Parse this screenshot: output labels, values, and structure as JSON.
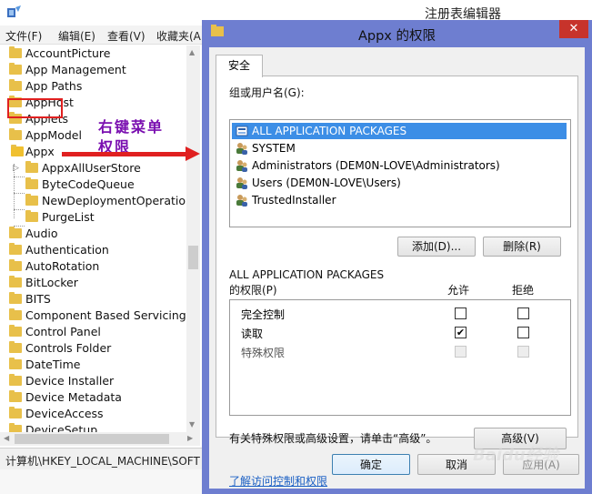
{
  "registry": {
    "title": "注册表编辑器",
    "menu": [
      "文件(F)",
      "编辑(E)",
      "查看(V)",
      "收藏夹(A"
    ],
    "tree_top": [
      "AccountPicture",
      "App Management",
      "App Paths",
      "AppHost",
      "Applets",
      "AppModel"
    ],
    "selected_key": "Appx",
    "children": [
      "AppxAllUserStore",
      "ByteCodeQueue",
      "NewDeploymentOperation",
      "PurgeList"
    ],
    "tree_bottom": [
      "Audio",
      "Authentication",
      "AutoRotation",
      "BitLocker",
      "BITS",
      "Component Based Servicing",
      "Control Panel",
      "Controls Folder",
      "DateTime",
      "Device Installer",
      "Device Metadata",
      "DeviceAccess",
      "DeviceSetup"
    ],
    "status_path": "计算机\\HKEY_LOCAL_MACHINE\\SOFT"
  },
  "annotation": {
    "line1": "右键菜单",
    "line2": "权限"
  },
  "dialog": {
    "title": "Appx 的权限",
    "close": "✕",
    "tab": "安全",
    "group_label": "组或用户名(G):",
    "users": [
      "ALL APPLICATION PACKAGES",
      "SYSTEM",
      "Administrators (DEM0N-LOVE\\Administrators)",
      "Users (DEM0N-LOVE\\Users)",
      "TrustedInstaller"
    ],
    "add_button": "添加(D)...",
    "remove_button": "删除(R)",
    "perm_for_line1": "ALL APPLICATION PACKAGES",
    "perm_for_line2": "的权限(P)",
    "allow_header": "允许",
    "deny_header": "拒绝",
    "permissions": [
      {
        "name": "完全控制",
        "allow": false,
        "deny": false,
        "disabled": false
      },
      {
        "name": "读取",
        "allow": true,
        "deny": false,
        "disabled": false
      },
      {
        "name": "特殊权限",
        "allow": false,
        "deny": false,
        "disabled": true
      }
    ],
    "advanced_hint": "有关特殊权限或高级设置，请单击“高级”。",
    "advanced_button": "高级(V)",
    "learn_link": "了解访问控制和权限",
    "ok_button": "确定",
    "cancel_button": "取消",
    "apply_button": "应用(A)"
  },
  "watermark": "Baidu经验",
  "colors": {
    "dialog_frame": "#6e7ed0",
    "selection": "#3c8ee6",
    "highlight_box": "#e02020",
    "annotation_text": "#7a0fb0",
    "close_button": "#c7332b"
  }
}
